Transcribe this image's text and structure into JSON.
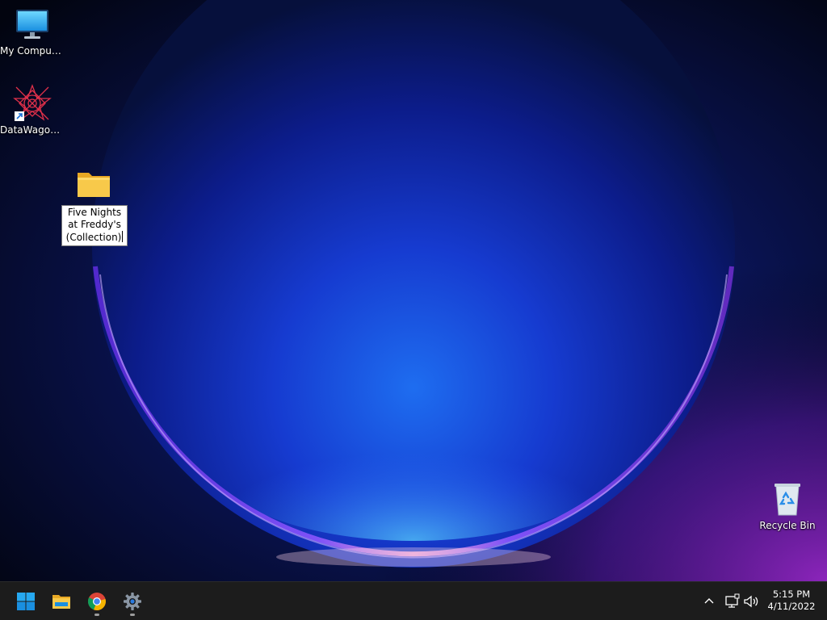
{
  "desktop": {
    "icons": [
      {
        "label": "My Computer"
      },
      {
        "label": "DataWagon..."
      },
      {
        "label": "Recycle Bin"
      }
    ],
    "renaming_folder": {
      "value": "Five Nights at Freddy's (Collection)"
    }
  },
  "taskbar": {
    "apps": [
      {
        "icon": "windows-start-icon"
      },
      {
        "icon": "file-explorer-icon"
      },
      {
        "icon": "chrome-icon"
      },
      {
        "icon": "settings-gear-icon"
      }
    ],
    "tray": {
      "icons": [
        "chevron-up-icon",
        "network-icon",
        "volume-icon"
      ],
      "time": "5:15 PM",
      "date": "4/11/2022"
    }
  },
  "colors": {
    "taskbar_bg": "#1c1c1c",
    "folder_yellow": "#f8c94a",
    "start_blue": "#26a8f0"
  }
}
